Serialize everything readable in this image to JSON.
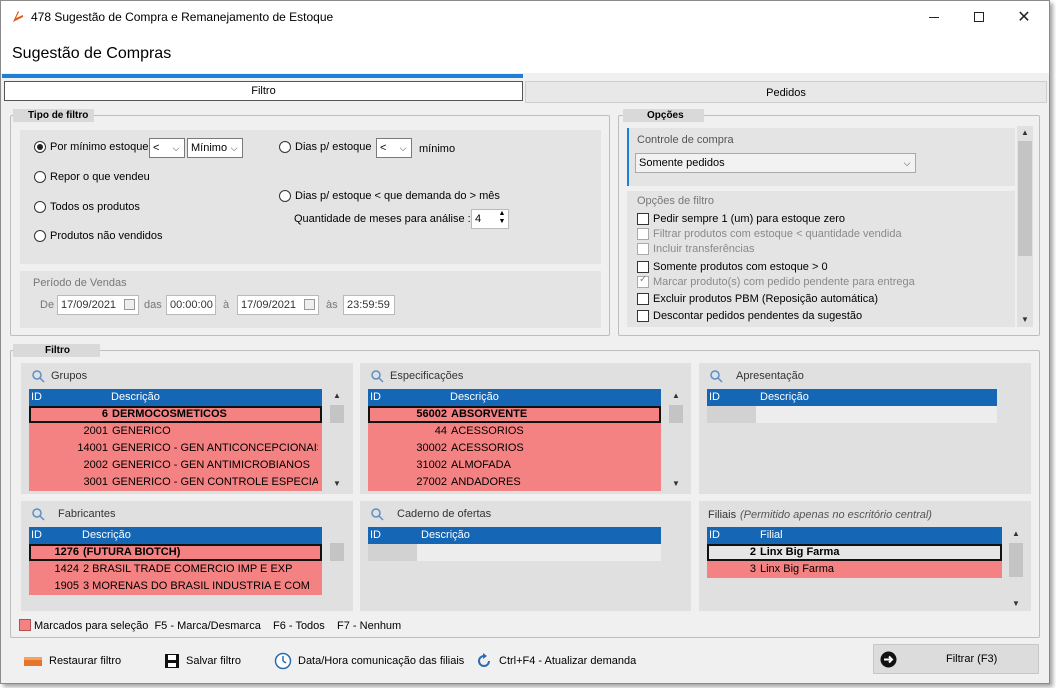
{
  "window": {
    "title": "478 Sugestão de Compra e Remanejamento de Estoque",
    "header": "Sugestão de Compras",
    "minimize_icon": "minimize-icon",
    "maximize_icon": "maximize-icon",
    "close_icon": "close-icon"
  },
  "tabs": [
    {
      "label": "Filtro",
      "active": true
    },
    {
      "label": "Pedidos",
      "active": false
    }
  ],
  "tipo_filtro": {
    "label": "Tipo de filtro",
    "options": {
      "por_minimo": "Por mínimo estoque",
      "repor": "Repor o que vendeu",
      "todos": "Todos os produtos",
      "nao_vendidos": "Produtos não vendidos",
      "dias_estoque": "Dias p/ estoque",
      "dias_demanda": "Dias p/ estoque < que demanda do > mês"
    },
    "op_value": "<",
    "minimo_value": "Mínimo",
    "dias_op_value": "<",
    "minimo_label": "mínimo",
    "meses_label": "Quantidade de meses para análise :",
    "meses_value": "4",
    "selected": "por_minimo"
  },
  "periodo": {
    "title": "Período de Vendas",
    "de_label": "De",
    "date_from": "17/09/2021",
    "das_label": "das",
    "time_from": "00:00:00",
    "a_label": "à",
    "date_to": "17/09/2021",
    "as_label": "às",
    "time_to": "23:59:59"
  },
  "opcoes": {
    "label": "Opções",
    "controle_title": "Controle de compra",
    "controle_value": "Somente pedidos",
    "filtro_title": "Opções de filtro",
    "checks": [
      {
        "label": "Pedir sempre 1 (um) para estoque zero",
        "enabled": true,
        "checked": false
      },
      {
        "label": "Filtrar produtos com estoque < quantidade vendida",
        "enabled": false,
        "checked": false
      },
      {
        "label": "Incluir transferências",
        "enabled": false,
        "checked": false
      },
      {
        "label": "Somente produtos com estoque > 0",
        "enabled": true,
        "checked": false
      },
      {
        "label": "Marcar produto(s) com pedido pendente para entrega",
        "enabled": false,
        "checked": true
      },
      {
        "label": "Excluir produtos PBM (Reposição automática)",
        "enabled": true,
        "checked": false
      },
      {
        "label": "Descontar pedidos pendentes da sugestão",
        "enabled": true,
        "checked": false
      }
    ]
  },
  "filtro": {
    "label": "Filtro",
    "grupos": {
      "title": "Grupos",
      "col_id": "ID",
      "col_desc": "Descrição",
      "rows": [
        {
          "id": "6",
          "desc": "DERMOCOSMETICOS"
        },
        {
          "id": "2001",
          "desc": "GENERICO"
        },
        {
          "id": "14001",
          "desc": "GENERICO - GEN ANTICONCEPCIONAIS"
        },
        {
          "id": "2002",
          "desc": "GENERICO - GEN ANTIMICROBIANOS"
        },
        {
          "id": "3001",
          "desc": "GENERICO - GEN CONTROLE ESPECIAL"
        }
      ]
    },
    "especificacoes": {
      "title": "Especificações",
      "col_id": "ID",
      "col_desc": "Descrição",
      "rows": [
        {
          "id": "56002",
          "desc": "ABSORVENTE"
        },
        {
          "id": "44",
          "desc": "ACESSORIOS"
        },
        {
          "id": "30002",
          "desc": "ACESSORIOS"
        },
        {
          "id": "31002",
          "desc": "ALMOFADA"
        },
        {
          "id": "27002",
          "desc": "ANDADORES"
        }
      ]
    },
    "apresentacao": {
      "title": "Apresentação",
      "col_id": "ID",
      "col_desc": "Descrição"
    },
    "fabricantes": {
      "title": "Fabricantes",
      "col_id": "ID",
      "col_desc": "Descrição",
      "rows": [
        {
          "id": "1276",
          "desc": "(FUTURA BIOTCH)"
        },
        {
          "id": "1424",
          "desc": "2 BRASIL TRADE COMERCIO IMP E EXP"
        },
        {
          "id": "1905",
          "desc": "3 MORENAS DO BRASIL INDUSTRIA E COM"
        }
      ]
    },
    "caderno": {
      "title": "Caderno de ofertas",
      "col_id": "ID",
      "col_desc": "Descrição"
    },
    "filiais": {
      "title": "Filiais",
      "note": "(Permitido apenas no escritório central)",
      "col_id": "ID",
      "col_desc": "Filial",
      "rows": [
        {
          "id": "2",
          "desc": "Linx Big Farma"
        },
        {
          "id": "3",
          "desc": "Linx Big Farma"
        }
      ]
    },
    "legend": "Marcados para seleção  F5 - Marca/Desmarca    F6 - Todos    F7 - Nenhum"
  },
  "bottom": {
    "restaurar": "Restaurar filtro",
    "salvar": "Salvar filtro",
    "datahora": "Data/Hora comunicação das filiais",
    "atualizar": "Ctrl+F4 - Atualizar demanda",
    "filtrar": "Filtrar (F3)"
  },
  "colors": {
    "accent": "#1e7fd6",
    "grid_header": "#1566b5",
    "marked_row": "#f58282"
  }
}
